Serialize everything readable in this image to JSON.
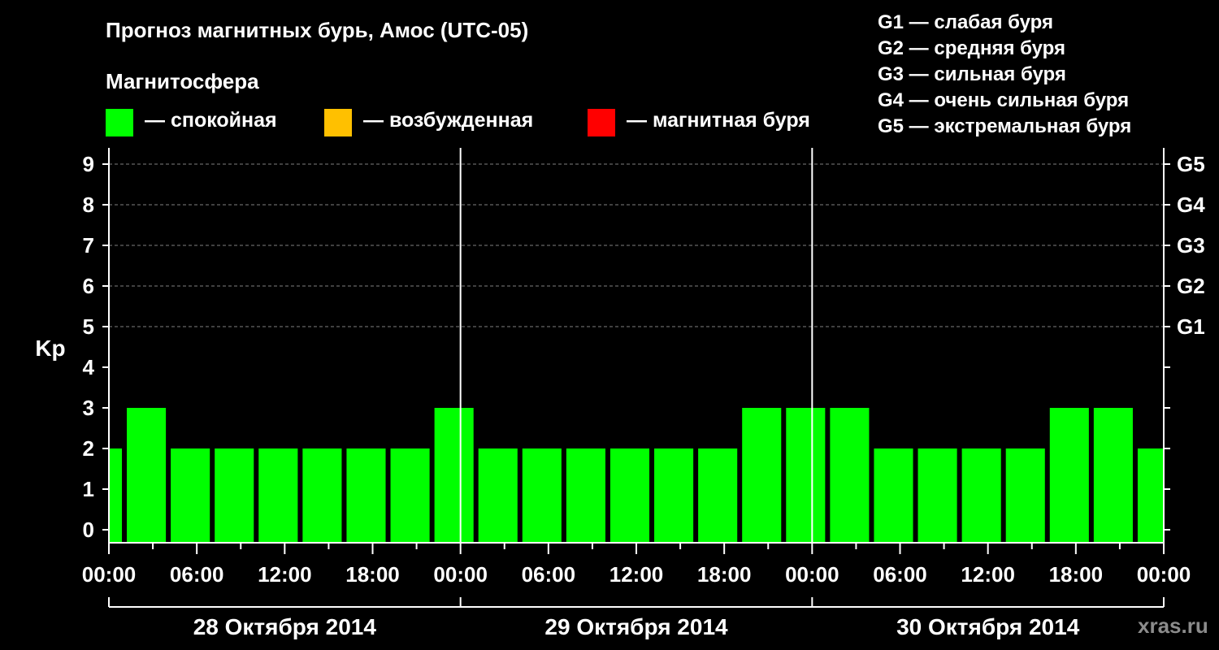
{
  "title": "Прогноз магнитных бурь, Амос (UTC-05)",
  "legend": {
    "heading": "Магнитосфера",
    "items": [
      {
        "label": "— спокойная",
        "color": "#00ff00"
      },
      {
        "label": "— возбужденная",
        "color": "#ffc000"
      },
      {
        "label": "— магнитная буря",
        "color": "#ff0000"
      }
    ]
  },
  "storm_scale": [
    "G1 — слабая буря",
    "G2 — средняя буря",
    "G3 — сильная буря",
    "G4 — очень сильная буря",
    "G5 — экстремальная буря"
  ],
  "watermark": "xras.ru",
  "chart_data": {
    "type": "bar",
    "ylabel": "Kp",
    "ylim": [
      0,
      9
    ],
    "y_ticks": [
      "0",
      "1",
      "2",
      "3",
      "4",
      "5",
      "6",
      "7",
      "8",
      "9"
    ],
    "right_ticks": [
      {
        "kp": 5,
        "label": "G1"
      },
      {
        "kp": 6,
        "label": "G2"
      },
      {
        "kp": 7,
        "label": "G3"
      },
      {
        "kp": 8,
        "label": "G4"
      },
      {
        "kp": 9,
        "label": "G5"
      }
    ],
    "grid": "dashed horizontal at Kp 5–9",
    "x_hours_range": [
      0,
      72
    ],
    "x_tick_labels": [
      "00:00",
      "06:00",
      "12:00",
      "18:00",
      "00:00",
      "06:00",
      "12:00",
      "18:00",
      "00:00",
      "06:00",
      "12:00",
      "18:00",
      "00:00"
    ],
    "days": [
      "28 Октября 2014",
      "29 Октября 2014",
      "30 Октября 2014"
    ],
    "bar_color": "#00ff00",
    "bars": [
      {
        "start_hour": -2,
        "kp": 2
      },
      {
        "start_hour": 1,
        "kp": 3
      },
      {
        "start_hour": 4,
        "kp": 2
      },
      {
        "start_hour": 7,
        "kp": 2
      },
      {
        "start_hour": 10,
        "kp": 2
      },
      {
        "start_hour": 13,
        "kp": 2
      },
      {
        "start_hour": 16,
        "kp": 2
      },
      {
        "start_hour": 19,
        "kp": 2
      },
      {
        "start_hour": 22,
        "kp": 3
      },
      {
        "start_hour": 25,
        "kp": 2
      },
      {
        "start_hour": 28,
        "kp": 2
      },
      {
        "start_hour": 31,
        "kp": 2
      },
      {
        "start_hour": 34,
        "kp": 2
      },
      {
        "start_hour": 37,
        "kp": 2
      },
      {
        "start_hour": 40,
        "kp": 2
      },
      {
        "start_hour": 43,
        "kp": 3
      },
      {
        "start_hour": 46,
        "kp": 3
      },
      {
        "start_hour": 49,
        "kp": 3
      },
      {
        "start_hour": 52,
        "kp": 2
      },
      {
        "start_hour": 55,
        "kp": 2
      },
      {
        "start_hour": 58,
        "kp": 2
      },
      {
        "start_hour": 61,
        "kp": 2
      },
      {
        "start_hour": 64,
        "kp": 3
      },
      {
        "start_hour": 67,
        "kp": 3
      },
      {
        "start_hour": 70,
        "kp": 2
      }
    ]
  }
}
